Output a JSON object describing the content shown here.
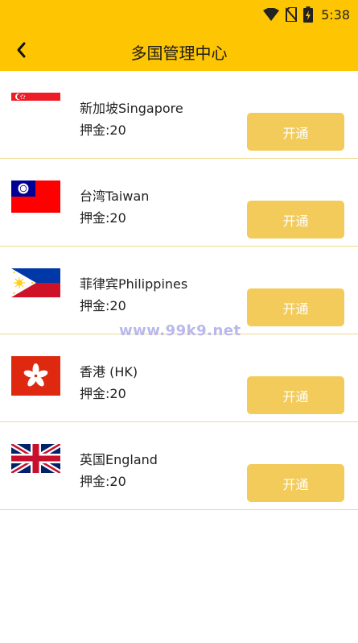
{
  "status_bar": {
    "time": "5:38",
    "icons": [
      "wifi-icon",
      "no-sim-icon",
      "battery-charging-icon"
    ]
  },
  "toolbar": {
    "title": "多国管理中心",
    "back_icon": "chevron-left-icon"
  },
  "countries": [
    {
      "name": "新加坡Singapore",
      "deposit": "押金:20",
      "button": "开通",
      "flag": "singapore-flag-icon"
    },
    {
      "name": "台湾Taiwan",
      "deposit": "押金:20",
      "button": "开通",
      "flag": "taiwan-flag-icon"
    },
    {
      "name": "菲律宾Philippines",
      "deposit": "押金:20",
      "button": "开通",
      "flag": "philippines-flag-icon"
    },
    {
      "name": "香港 (HK)",
      "deposit": "押金:20",
      "button": "开通",
      "flag": "hong-kong-flag-icon"
    },
    {
      "name": "英国England",
      "deposit": "押金:20",
      "button": "开通",
      "flag": "uk-flag-icon"
    }
  ],
  "watermark": "www.99k9.net",
  "colors": {
    "header": "#fdc502",
    "button": "#f2cb5a",
    "divider": "#efd98c"
  }
}
